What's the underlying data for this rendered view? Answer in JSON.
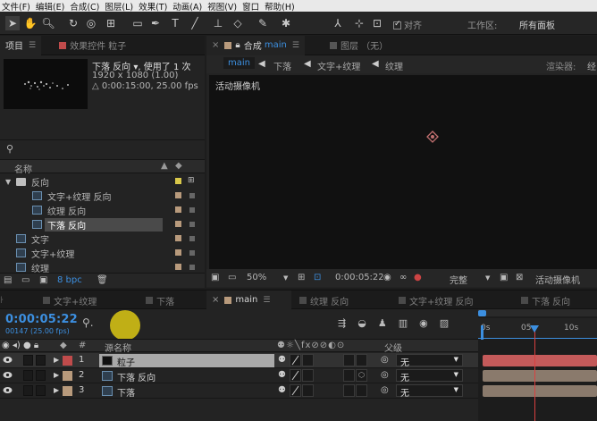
{
  "menu": [
    "文件(F)",
    "编辑(E)",
    "合成(C)",
    "图层(L)",
    "效果(T)",
    "动画(A)",
    "视图(V)",
    "窗口",
    "帮助(H)"
  ],
  "toolbar": {
    "snap_label": "对齐",
    "workspace_label": "工作区:",
    "workspace_value": "所有面板"
  },
  "project_panel": {
    "tab_project": "项目",
    "tab_effects": "效果控件 粒子",
    "selected_name": "下落 反向",
    "used_count": ", 使用了 1 次",
    "resolution": "1920 x 1080 (1.00)",
    "duration": "△ 0:00:15:00, 25.00 fps",
    "col_name": "名称",
    "items": [
      {
        "name": "反向",
        "type": "folder",
        "indent": 1,
        "label_color": "#d9c84a"
      },
      {
        "name": "文字+纹理 反向",
        "type": "comp",
        "indent": 2,
        "label_color": "#b89a7c"
      },
      {
        "name": "纹理 反向",
        "type": "comp",
        "indent": 2,
        "label_color": "#b89a7c"
      },
      {
        "name": "下落 反向",
        "type": "comp",
        "indent": 2,
        "label_color": "#b89a7c",
        "selected": true
      },
      {
        "name": "文字",
        "type": "comp",
        "indent": 1,
        "label_color": "#b89a7c"
      },
      {
        "name": "文字+纹理",
        "type": "comp",
        "indent": 1,
        "label_color": "#b89a7c"
      },
      {
        "name": "纹理",
        "type": "comp",
        "indent": 1,
        "label_color": "#b89a7c"
      }
    ],
    "bit_depth": "8 bpc"
  },
  "comp_panel": {
    "tab_comp": "合成",
    "tab_comp_name": "main",
    "tab_layer": "图层 （无）",
    "nav": [
      "main",
      "下落",
      "文字+纹理",
      "纹理"
    ],
    "renderer_label": "渲染器:",
    "renderer_value": "经",
    "camera_label": "活动摄像机",
    "zoom": "50%",
    "timecode": "0:00:05:22",
    "quality": "完整",
    "view_camera": "活动摄像机"
  },
  "timeline_tabs": [
    "文字+纹理",
    "下落",
    "main",
    "纹理 反向",
    "文字+纹理 反向",
    "下落 反向"
  ],
  "timeline": {
    "timecode": "0:00:05:22",
    "frames": "00147 (25.00 fps)",
    "col_num": "#",
    "col_source": "源名称",
    "col_parent": "父级",
    "ruler": [
      "0s",
      "05",
      "10s"
    ],
    "playhead_fraction": 0.39,
    "layers": [
      {
        "num": "1",
        "name": "粒子",
        "color": "#c04b4b",
        "parent": "无",
        "bar_color": "#c45a5a",
        "selected": true,
        "solid": true
      },
      {
        "num": "2",
        "name": "下落 反向",
        "color": "#b89a7c",
        "parent": "无",
        "bar_color": "#8a7a6c"
      },
      {
        "num": "3",
        "name": "下落",
        "color": "#b89a7c",
        "parent": "无",
        "bar_color": "#8a7a6c"
      }
    ]
  }
}
